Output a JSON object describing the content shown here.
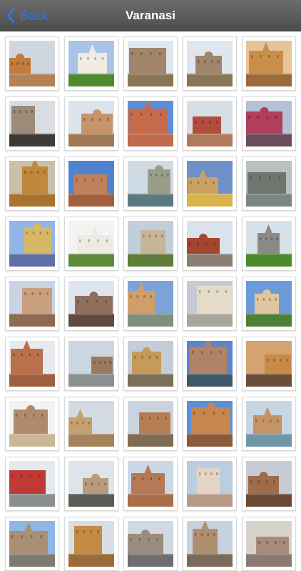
{
  "navbar": {
    "back_label": "Back",
    "back_icon": "chevron-left-icon",
    "title": "Varanasi",
    "colors": {
      "bar": "#5a5a5a",
      "accent": "#1e7cf2",
      "title": "#ffffff"
    }
  },
  "gallery": {
    "photos": [
      {
        "subject": "ghat-rooftops",
        "sky": "#cfd6de",
        "ground": "#b48055",
        "building": "#c27a3e"
      },
      {
        "subject": "white-mansion",
        "sky": "#a9c4e8",
        "ground": "#4f8a2f",
        "building": "#f0ece2"
      },
      {
        "subject": "riverside-fort",
        "sky": "#dfe6ee",
        "ground": "#8a7656",
        "building": "#a1856a"
      },
      {
        "subject": "riverside-fort",
        "sky": "#dfe6ee",
        "ground": "#8a7656",
        "building": "#a1856a"
      },
      {
        "subject": "ghat-sunset",
        "sky": "#e7c39a",
        "ground": "#9a6a3a",
        "building": "#c98f4a"
      },
      {
        "subject": "palace-ghat",
        "sky": "#d9dde2",
        "ground": "#3e3a35",
        "building": "#9c8b78"
      },
      {
        "subject": "temple-domes",
        "sky": "#dde3ea",
        "ground": "#a07a55",
        "building": "#c9936a"
      },
      {
        "subject": "red-fort-wall",
        "sky": "#5d8fd6",
        "ground": "#c06a4e",
        "building": "#c56b4c"
      },
      {
        "subject": "temple-shrine",
        "sky": "#d8dee6",
        "ground": "#b07a5c",
        "building": "#b24c3c"
      },
      {
        "subject": "red-temple",
        "sky": "#b3c2d6",
        "ground": "#6b4b5e",
        "building": "#b23e5c"
      },
      {
        "subject": "sandstone-ghat",
        "sky": "#c8c0a8",
        "ground": "#a8732f",
        "building": "#c0873e"
      },
      {
        "subject": "domed-palace",
        "sky": "#4f82cf",
        "ground": "#a05f3f",
        "building": "#c0805a"
      },
      {
        "subject": "ghat-boats",
        "sky": "#cfdbe4",
        "ground": "#5a7a7f",
        "building": "#9b9d8c"
      },
      {
        "subject": "colorful-ghat",
        "sky": "#6e90c9",
        "ground": "#d8b24a",
        "building": "#c9a160"
      },
      {
        "subject": "misty-domes",
        "sky": "#b9c0c2",
        "ground": "#7b8584",
        "building": "#6f7670"
      },
      {
        "subject": "colorful-ghat",
        "sky": "#8fb6e6",
        "ground": "#5f6ea6",
        "building": "#d6b866"
      },
      {
        "subject": "white-building",
        "sky": "#f3f3f3",
        "ground": "#5d8a3a",
        "building": "#ecebe4"
      },
      {
        "subject": "heritage-hotel",
        "sky": "#c3cedc",
        "ground": "#5f7d3a",
        "building": "#c7b59a"
      },
      {
        "subject": "church",
        "sky": "#d9e3ee",
        "ground": "#8a7f73",
        "building": "#a4452e"
      },
      {
        "subject": "stupa-tree",
        "sky": "#d7e1ea",
        "ground": "#4a8a2d",
        "building": "#8b8a86"
      },
      {
        "subject": "shikhara-temple",
        "sky": "#c8d4e4",
        "ground": "#8f6a4f",
        "building": "#c9a07f"
      },
      {
        "subject": "temple-spires",
        "sky": "#dfe5ec",
        "ground": "#5e4a3e",
        "building": "#8e6f5e"
      },
      {
        "subject": "riverbank-temples",
        "sky": "#7ba3d8",
        "ground": "#7d8f7f",
        "building": "#cf9e6a"
      },
      {
        "subject": "arched-hall",
        "sky": "#c4cbd6",
        "ground": "#a8a59a",
        "building": "#e4dcc8"
      },
      {
        "subject": "temple-garden",
        "sky": "#6b9ad8",
        "ground": "#4f7f35",
        "building": "#e0c6a0"
      },
      {
        "subject": "ghat-evening",
        "sky": "#e6e9ee",
        "ground": "#9f5e3e",
        "building": "#b8714a"
      },
      {
        "subject": "river-temple",
        "sky": "#cbd6e0",
        "ground": "#8a8f8f",
        "building": "#9a7a5f"
      },
      {
        "subject": "golden-ghat",
        "sky": "#c3cdd7",
        "ground": "#7b6f58",
        "building": "#c69b57"
      },
      {
        "subject": "crowded-ghat",
        "sky": "#5b86c9",
        "ground": "#3f5768",
        "building": "#b0826a"
      },
      {
        "subject": "sandstone-cliff",
        "sky": "#d4a370",
        "ground": "#6b4e3a",
        "building": "#c98a48"
      },
      {
        "subject": "stupa",
        "sky": "#f2f2f2",
        "ground": "#c9b896",
        "building": "#b08a6a"
      },
      {
        "subject": "ghat-houses",
        "sky": "#d4dae2",
        "ground": "#a5825c",
        "building": "#c7a06f"
      },
      {
        "subject": "riverside-houses",
        "sky": "#cbd4de",
        "ground": "#7f6a54",
        "building": "#b77d52"
      },
      {
        "subject": "grand-palace",
        "sky": "#5a90d8",
        "ground": "#8a5a3a",
        "building": "#c7864e"
      },
      {
        "subject": "distant-ghat",
        "sky": "#c7d6e4",
        "ground": "#6f97a6",
        "building": "#c49463"
      },
      {
        "subject": "red-building-steps",
        "sky": "#e4e9ee",
        "ground": "#8a8f8d",
        "building": "#c03a35"
      },
      {
        "subject": "carved-gateway",
        "sky": "#dfe4ea",
        "ground": "#5b5b55",
        "building": "#b99a7a"
      },
      {
        "subject": "ruined-stupa",
        "sky": "#cbd8e6",
        "ground": "#a76f48",
        "building": "#b57a55"
      },
      {
        "subject": "white-temple",
        "sky": "#bccde0",
        "ground": "#b79a86",
        "building": "#e6d4c4"
      },
      {
        "subject": "palace-ghat",
        "sky": "#c6ccd5",
        "ground": "#6a4a35",
        "building": "#9e6c48"
      },
      {
        "subject": "partial",
        "sky": "#8fb6e2",
        "ground": "#7e7a70",
        "building": "#a88f76"
      },
      {
        "subject": "partial",
        "sky": "#d8dee6",
        "ground": "#9a6a3a",
        "building": "#c48b45"
      },
      {
        "subject": "partial",
        "sky": "#d2d8df",
        "ground": "#6e6e6e",
        "building": "#9a8d80"
      },
      {
        "subject": "partial",
        "sky": "#c6d2de",
        "ground": "#7a6a5a",
        "building": "#b08f70"
      },
      {
        "subject": "partial",
        "sky": "#d8d2cc",
        "ground": "#8a7a72",
        "building": "#a88a7a"
      }
    ]
  }
}
